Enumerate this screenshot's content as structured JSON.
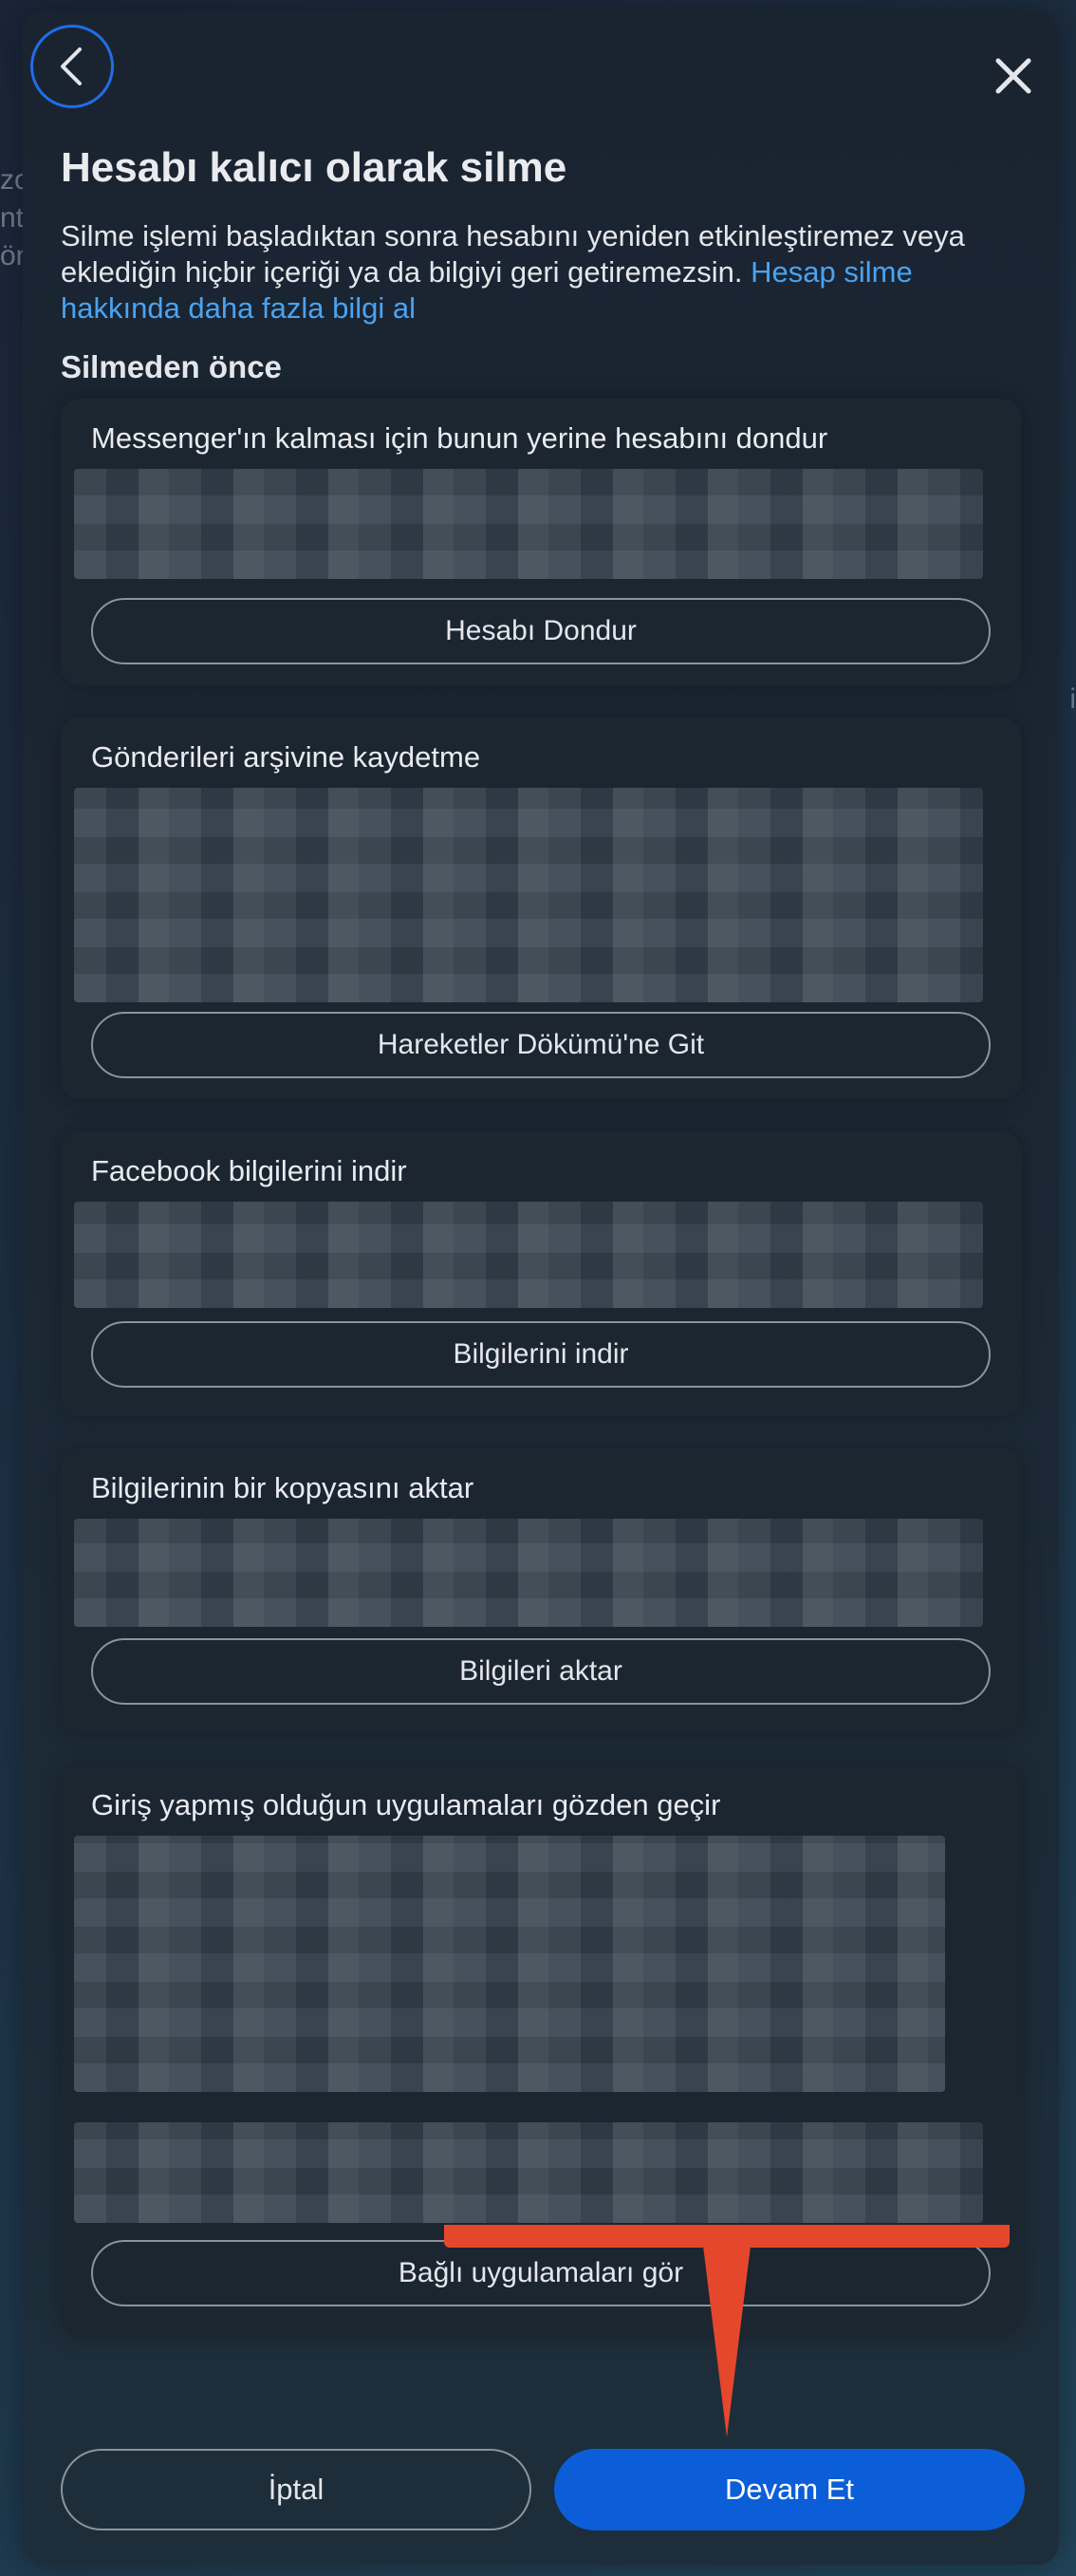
{
  "header": {
    "title": "Hesabı kalıcı olarak silme",
    "description": "Silme işlemi başladıktan sonra hesabını yeniden etkinleştiremez veya eklediğin hiçbir içeriği ya da bilgiyi geri getiremezsin.",
    "learn_more_link": "Hesap silme hakkında daha fazla bilgi al"
  },
  "section_title": "Silmeden önce",
  "cards": [
    {
      "title": "Messenger'ın kalması için bunun yerine hesabını dondur",
      "button": "Hesabı Dondur"
    },
    {
      "title": "Gönderileri arşivine kaydetme",
      "button": "Hareketler Dökümü'ne Git"
    },
    {
      "title": "Facebook bilgilerini indir",
      "button": "Bilgilerini indir"
    },
    {
      "title": "Bilgilerinin bir kopyasını aktar",
      "button": "Bilgileri aktar"
    },
    {
      "title": "Giriş yapmış olduğun uygulamaları gözden geçir",
      "button": "Bağlı uygulamaları gör"
    }
  ],
  "footer": {
    "cancel_label": "İptal",
    "continue_label": "Devam Et"
  },
  "icons": {
    "back": "chevron-left-icon",
    "close": "close-icon"
  },
  "colors": {
    "accent": "#0b5ed7",
    "link": "#4aa3f0",
    "annotation": "#e5472d"
  }
}
